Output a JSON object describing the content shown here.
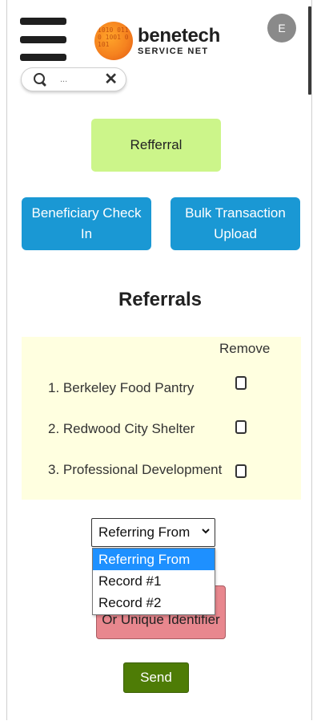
{
  "header": {
    "logo_name": "benetech",
    "logo_subtitle": "SERVICE NET",
    "avatar_initial": "E"
  },
  "search": {
    "placeholder": "...",
    "clear_label": "✕"
  },
  "actions": {
    "referral_label": "Refferral",
    "checkin_label": "Beneficiary Check In",
    "bulk_label": "Bulk Transaction Upload"
  },
  "referrals": {
    "heading": "Referrals",
    "remove_header": "Remove",
    "items": [
      {
        "label": "1. Berkeley Food Pantry"
      },
      {
        "label": "2. Redwood City Shelter"
      },
      {
        "label": "3. Professional Development"
      }
    ]
  },
  "referring_select": {
    "value": "Referring From",
    "options": [
      {
        "label": "Referring From",
        "selected": true
      },
      {
        "label": "Record #1",
        "selected": false
      },
      {
        "label": "Record #2",
        "selected": false
      }
    ]
  },
  "hidden_button": {
    "label": "Or Unique Identifier"
  },
  "send_label": "Send",
  "colors": {
    "referral_green": "#ccf58a",
    "primary_blue": "#1a98d4",
    "panel_yellow": "#ffffe0",
    "send_green": "#4e7c06",
    "pink_button": "#e8878e",
    "select_highlight": "#1e90ff"
  }
}
